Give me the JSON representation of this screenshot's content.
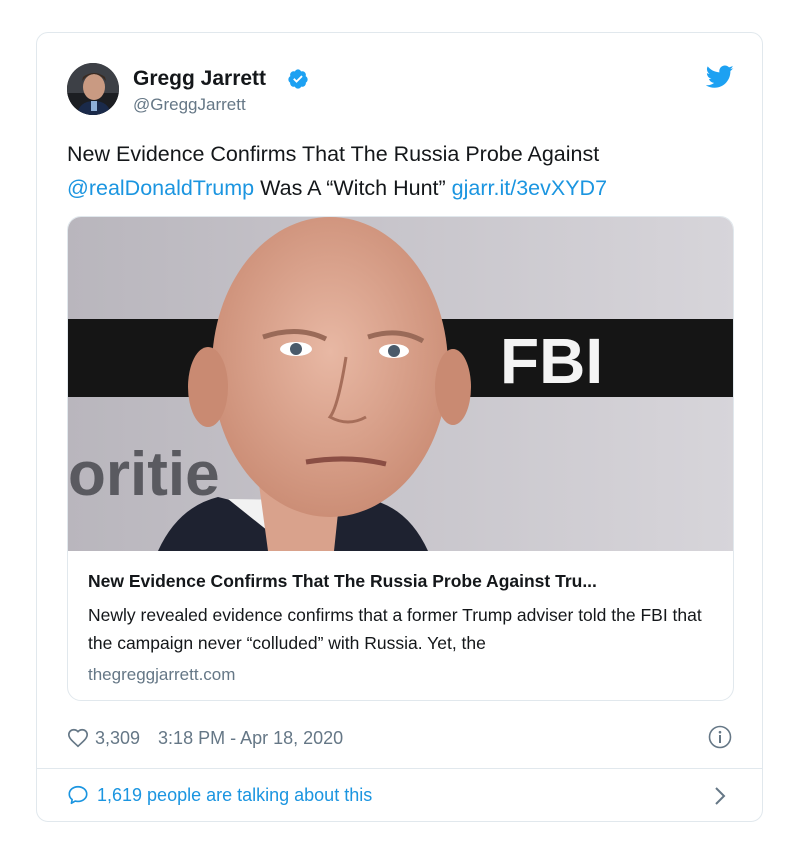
{
  "tweet": {
    "author": {
      "name": "Gregg Jarrett",
      "handle": "@GreggJarrett",
      "verified": true
    },
    "text": {
      "part1": "New Evidence Confirms That The Russia Probe Against",
      "mention": "@realDonaldTrump",
      "part2": " Was A “Witch Hunt” ",
      "url": "gjarr.it/3evXYD7"
    },
    "card": {
      "image_text": {
        "sign": "FBI",
        "left_word": "oritie"
      },
      "title": "New Evidence Confirms That The Russia Probe Against Tru...",
      "description": "Newly revealed evidence confirms that a former Trump adviser told the FBI that the campaign never “colluded” with Russia.  Yet, the",
      "domain": "thegreggjarrett.com"
    },
    "likes": "3,309",
    "timestamp": "3:18 PM - Apr 18, 2020",
    "talking": "1,619 people are talking about this"
  },
  "icons": {
    "verified": "verified-badge-icon",
    "bird": "twitter-bird-icon",
    "heart": "heart-icon",
    "info": "info-icon",
    "bubble": "speech-bubble-icon",
    "chevron": "chevron-right-icon"
  },
  "colors": {
    "link": "#1b95e0",
    "secondary_text": "#657786",
    "border": "#e1e8ed",
    "twitter_blue": "#1da1f2"
  }
}
